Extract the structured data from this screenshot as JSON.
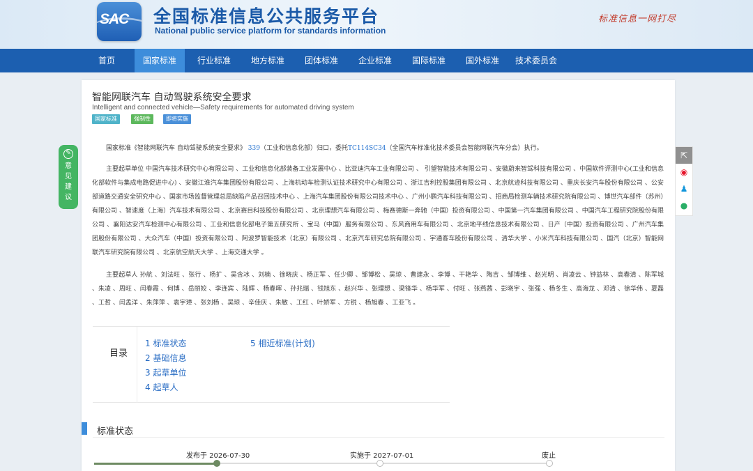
{
  "header": {
    "logo_text": "SAC",
    "title": "全国标准信息公共服务平台",
    "subtitle": "National public service platform for standards information",
    "slogan": "标准信息一网打尽"
  },
  "nav": {
    "items": [
      "首页",
      "国家标准",
      "行业标准",
      "地方标准",
      "团体标准",
      "企业标准",
      "国际标准",
      "国外标准",
      "技术委员会"
    ],
    "active_index": 1
  },
  "standard": {
    "title": "智能网联汽车 自动驾驶系统安全要求",
    "title_en": "Intelligent and connected vehicle—Safety requirements for automated driving system",
    "tags": [
      {
        "label": "国家标准",
        "color": "#4fb3c9"
      },
      {
        "label": "强制性",
        "color": "#5cb85c"
      },
      {
        "label": "即将实施",
        "color": "#4a90d9"
      }
    ]
  },
  "intro": {
    "prefix": "国家标准《智能网联汽车 自动驾驶系统安全要求》",
    "plan_link": "339",
    "mid": "（工业和信息化部）归口，委托",
    "tc_link": "TC114SC34",
    "suffix": "（全国汽车标准化技术委员会智能网联汽车分会）执行。"
  },
  "drafting_units": "主要起草单位 中国汽车技术研究中心有限公司 、工业和信息化部装备工业发展中心 、比亚迪汽车工业有限公司 、 引望智能技术有限公司 、安徽蔚来智驾科技有限公司 、中国软件评测中心(工业和信息化部软件与集成电路促进中心) 、安徽江淮汽车集团股份有限公司 、上海机动车检测认证技术研究中心有限公司 、浙江吉利控股集团有限公司 、北京航迹科技有限公司 、重庆长安汽车股份有限公司 、公安部道路交通安全研究中心 、国家市场监督管理总局缺陷产品召回技术中心 、上海汽车集团股份有限公司技术中心 、广州小鹏汽车科技有限公司 、招商局检测车辆技术研究院有限公司 、博世汽车部件（苏州）有限公司 、智速度（上海）汽车技术有限公司 、北京赛目科技股份有限公司 、北京理想汽车有限公司 、梅赛德斯一奔驰（中国）投资有限公司 、中国第一汽车集团有限公司 、中国汽车工程研究院股份有限公司 、襄阳达安汽车检测中心有限公司 、工业和信息化部电子第五研究所 、宝马（中国）服务有限公司 、东风商用车有限公司 、北京地平线信息技术有限公司 、日产（中国）投资有限公司 、广州汽车集团股份有限公司 、大众汽车（中国）投资有限公司 、阿波罗智能技术（北京）有限公司 、北京汽车研究总院有限公司 、宇通客车股份有限公司 、清华大学 、小米汽车科技有限公司 、国汽（北京）智能网联汽车研究院有限公司 、北京航空航天大学 、上海交通大学 。",
  "drafters": "主要起草人 孙航 、刘法旺 、张行 、杨扩 、吴含冰 、刘楠 、徐晓庆 、杨正军 、任少卿 、邹博松 、吴琼 、曹建永 、李博 、干艳华 、陶吉 、邹博维 、赵光明 、肖凌云 、钟益林 、高春清 、陈军城 、朱凌 、周旺 、闫春霞 、何博 、岳丽姣 、李连宾 、陆辉 、杨春晖 、孙兆瑞 、钱旭东 、赵兴华 、张理想 、梁锋华 、杨华军 、付旺 、张燕茜 、彭晓宇 、张强 、杨冬生 、高海龙 、邓清 、徐华伟 、夏磊 、工哲 、闫孟洋 、朱萍萍 、袁宇璋 、张刘杨 、吴琼 、辛佳庆 、朱敏 、工红 、叶娇军 、方锐 、杨旭春 、工亚飞 。",
  "toc": {
    "label": "目录",
    "items": [
      "1 标准状态",
      "2 基础信息",
      "3 起草单位",
      "4 起草人",
      "5 相近标准(计划)"
    ]
  },
  "status_section": {
    "title": "标准状态",
    "timeline": [
      {
        "label": "发布于 2026-07-30",
        "done": true
      },
      {
        "label": "实施于 2027-07-01",
        "done": false
      },
      {
        "label": "废止",
        "done": false
      }
    ],
    "progress_fraction": 0.27
  },
  "feedback": {
    "label": "意见建议"
  },
  "share": {
    "items": [
      "share-icon",
      "weibo-icon",
      "qq-icon",
      "wechat-icon"
    ]
  }
}
